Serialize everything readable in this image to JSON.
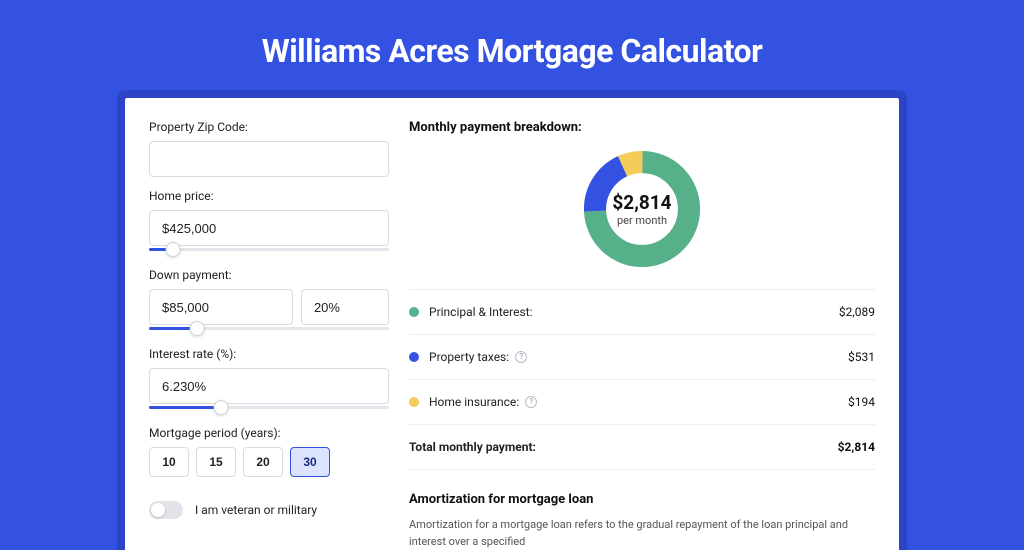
{
  "title": "Williams Acres Mortgage Calculator",
  "form": {
    "zip": {
      "label": "Property Zip Code:",
      "value": ""
    },
    "home_price": {
      "label": "Home price:",
      "value": "$425,000",
      "slider_pct": 10
    },
    "down_payment": {
      "label": "Down payment:",
      "amount": "$85,000",
      "pct": "20%",
      "slider_pct": 20
    },
    "interest": {
      "label": "Interest rate (%):",
      "value": "6.230%",
      "slider_pct": 30
    },
    "period": {
      "label": "Mortgage period (years):",
      "options": [
        "10",
        "15",
        "20",
        "30"
      ],
      "selected": "30"
    },
    "veteran": {
      "label": "I am veteran or military",
      "on": false
    }
  },
  "breakdown": {
    "title": "Monthly payment breakdown:",
    "center_amount": "$2,814",
    "center_sub": "per month",
    "items": [
      {
        "label": "Principal & Interest:",
        "value": "$2,089",
        "color": "#56b08a",
        "info": false
      },
      {
        "label": "Property taxes:",
        "value": "$531",
        "color": "#3452e1",
        "info": true
      },
      {
        "label": "Home insurance:",
        "value": "$194",
        "color": "#f3cd57",
        "info": true
      }
    ],
    "total": {
      "label": "Total monthly payment:",
      "value": "$2,814"
    }
  },
  "chart_data": {
    "type": "pie",
    "title": "Monthly payment breakdown",
    "series": [
      {
        "name": "Principal & Interest",
        "value": 2089,
        "color": "#56b08a"
      },
      {
        "name": "Property taxes",
        "value": 531,
        "color": "#3452e1"
      },
      {
        "name": "Home insurance",
        "value": 194,
        "color": "#f3cd57"
      }
    ],
    "total": 2814,
    "center_label": "$2,814 per month"
  },
  "amortization": {
    "title": "Amortization for mortgage loan",
    "text": "Amortization for a mortgage loan refers to the gradual repayment of the loan principal and interest over a specified"
  }
}
